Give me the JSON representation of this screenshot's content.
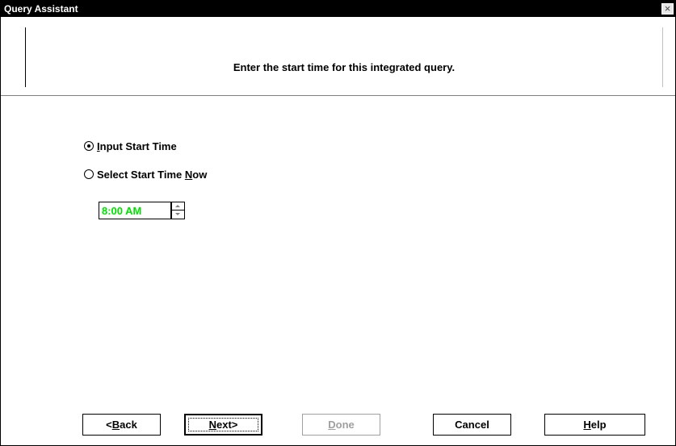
{
  "window": {
    "title": "Query Assistant",
    "close_glyph": "×"
  },
  "header": {
    "instruction": "Enter the start time for this integrated query."
  },
  "options": {
    "input_start_time": {
      "prefix": "",
      "accel": "I",
      "rest": "nput Start Time",
      "selected": true
    },
    "select_start_time_now": {
      "prefix": "Select Start Time ",
      "accel": "N",
      "rest": "ow",
      "selected": false
    }
  },
  "time_field": {
    "value": "8:00 AM",
    "color": "#00e000"
  },
  "buttons": {
    "back": {
      "prefix": "<",
      "accel": "B",
      "rest": "ack"
    },
    "next": {
      "prefix": "",
      "accel": "N",
      "rest": "ext>"
    },
    "done": {
      "prefix": "",
      "accel": "D",
      "rest": "one",
      "enabled": false
    },
    "cancel": {
      "label": "Cancel"
    },
    "help": {
      "prefix": "",
      "accel": "H",
      "rest": "elp"
    }
  }
}
